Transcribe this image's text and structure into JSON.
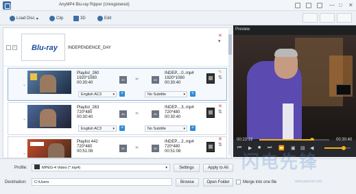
{
  "window": {
    "title": "AnyMP4 Blu-ray Ripper (Unregistered)",
    "controls": [
      "—",
      "□",
      "✕"
    ]
  },
  "toolbar": {
    "load_disc": "Load Disc",
    "clip": "Clip",
    "three_d": "3D",
    "edit": "Edit"
  },
  "disc": {
    "logo": "Blu-ray",
    "title": "INDEPENDENCE_DAY"
  },
  "items": [
    {
      "name": "Playlist_260",
      "resolution": "1920*1080",
      "duration": "00:30:40",
      "badge": "2D",
      "out_name": "INDEP....0..mp4",
      "out_resolution": "1920*1080",
      "out_duration": "00:30:40",
      "audio": "English AC3",
      "subtitle": "No Subtitle"
    },
    {
      "name": "Playlist_263",
      "resolution": "720*480",
      "duration": "00:30:40",
      "badge": "2D",
      "out_name": "INDEP....3..mp4",
      "out_resolution": "720*480",
      "out_duration": "00:30:40",
      "audio": "English AC3",
      "subtitle": "No Subtitle"
    },
    {
      "name": "Playlist 442",
      "resolution": "720*480",
      "duration": "00:51:08",
      "badge": "2D",
      "out_name": "INDEP....2..mp4",
      "out_resolution": "720*480",
      "out_duration": "00:51:08",
      "audio": "",
      "subtitle": ""
    }
  ],
  "preview": {
    "label": "Preview",
    "current_time": "00:23:19",
    "total_time": "00:30:40",
    "progress": 0.75,
    "volume": 0.74
  },
  "bottom": {
    "profile_label": "Profile:",
    "profile_value": "MPEG-4 Video (*.mp4)",
    "settings": "Settings",
    "apply_to_all": "Apply to All",
    "destination_label": "Destination:",
    "destination_value": "C:\\Users",
    "browse": "Browse",
    "open_folder": "Open Folder",
    "merge_label": "Merge into one file"
  },
  "watermark": {
    "text": "闪电先锋",
    "url": "www.greenxf.com"
  }
}
